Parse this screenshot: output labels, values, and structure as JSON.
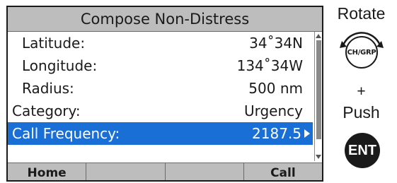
{
  "screen": {
    "title": "Compose Non-Distress",
    "rows": [
      {
        "label": "Latitude:",
        "value": "34˚34N"
      },
      {
        "label": "Longitude:",
        "value": "134˚34W"
      },
      {
        "label": "Radius:",
        "value": "500 nm"
      },
      {
        "label": "Category:",
        "value": "Urgency"
      },
      {
        "label": "Call Frequency:",
        "value": "2187.5"
      }
    ],
    "selected_row": 4,
    "selected_color": "#1a6fd6",
    "softkeys": [
      "Home",
      "",
      "",
      "Call"
    ]
  },
  "instructions": {
    "rotate": "Rotate",
    "knob_label": "CH/GRP",
    "plus": "+",
    "push": "Push",
    "ent_label": "ENT"
  }
}
